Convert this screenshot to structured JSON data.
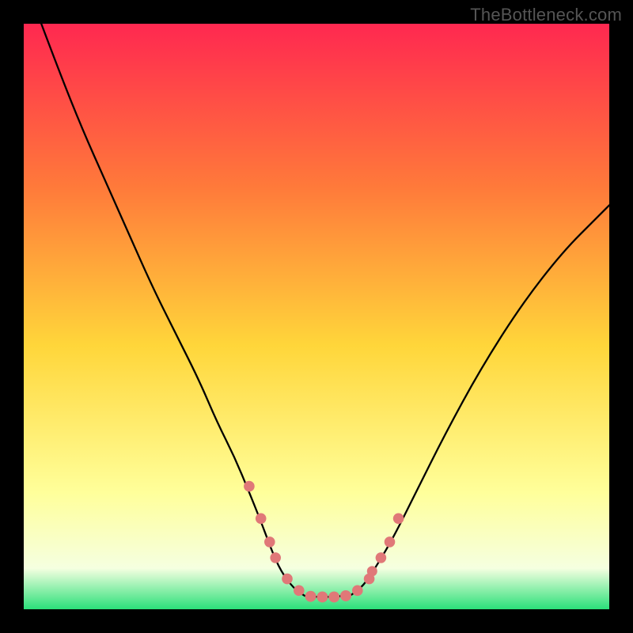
{
  "watermark": "TheBottleneck.com",
  "colors": {
    "frame": "#000000",
    "gradient_top": "#ff2850",
    "gradient_mid1": "#ff7a3a",
    "gradient_mid2": "#ffd63a",
    "gradient_mid3": "#ffff9a",
    "gradient_low": "#f5ffe0",
    "gradient_bottom": "#2be07a",
    "curve": "#000000",
    "marker_fill": "#e07878",
    "marker_stroke": "#b85050"
  },
  "chart_data": {
    "type": "line",
    "title": "",
    "xlabel": "",
    "ylabel": "",
    "xlim": [
      0,
      100
    ],
    "ylim": [
      0,
      100
    ],
    "series": [
      {
        "name": "curve-left",
        "x": [
          3,
          6,
          10,
          14,
          18,
          22,
          26,
          30,
          33,
          36,
          38.5,
          40.5,
          42,
          43,
          44,
          45,
          46,
          47,
          48
        ],
        "y": [
          100,
          92,
          82,
          73,
          64,
          55,
          47,
          39,
          32,
          26,
          20,
          15,
          11,
          8.5,
          6.5,
          5,
          3.8,
          2.9,
          2.3
        ]
      },
      {
        "name": "curve-floor",
        "x": [
          48,
          50,
          52,
          54,
          56
        ],
        "y": [
          2.3,
          2.1,
          2.1,
          2.2,
          2.5
        ]
      },
      {
        "name": "curve-right",
        "x": [
          56,
          58,
          60,
          63,
          67,
          72,
          78,
          85,
          92,
          98,
          100
        ],
        "y": [
          2.5,
          4,
          7,
          12,
          20,
          30,
          41,
          52,
          61,
          67,
          69
        ]
      }
    ],
    "markers": {
      "name": "highlight-points",
      "x": [
        38.5,
        40.5,
        42,
        43,
        45,
        47,
        49,
        51,
        53,
        55,
        57,
        59,
        61,
        59.5,
        62.5,
        64
      ],
      "y": [
        21,
        15.5,
        11.5,
        8.8,
        5.2,
        3.2,
        2.2,
        2.1,
        2.1,
        2.3,
        3.2,
        5.2,
        8.8,
        6.5,
        11.5,
        15.5
      ],
      "r": [
        6.8,
        6.8,
        6.8,
        6.8,
        6.8,
        6.8,
        7,
        7,
        7,
        7,
        6.8,
        6.8,
        6.8,
        6.5,
        6.8,
        6.8
      ]
    }
  }
}
